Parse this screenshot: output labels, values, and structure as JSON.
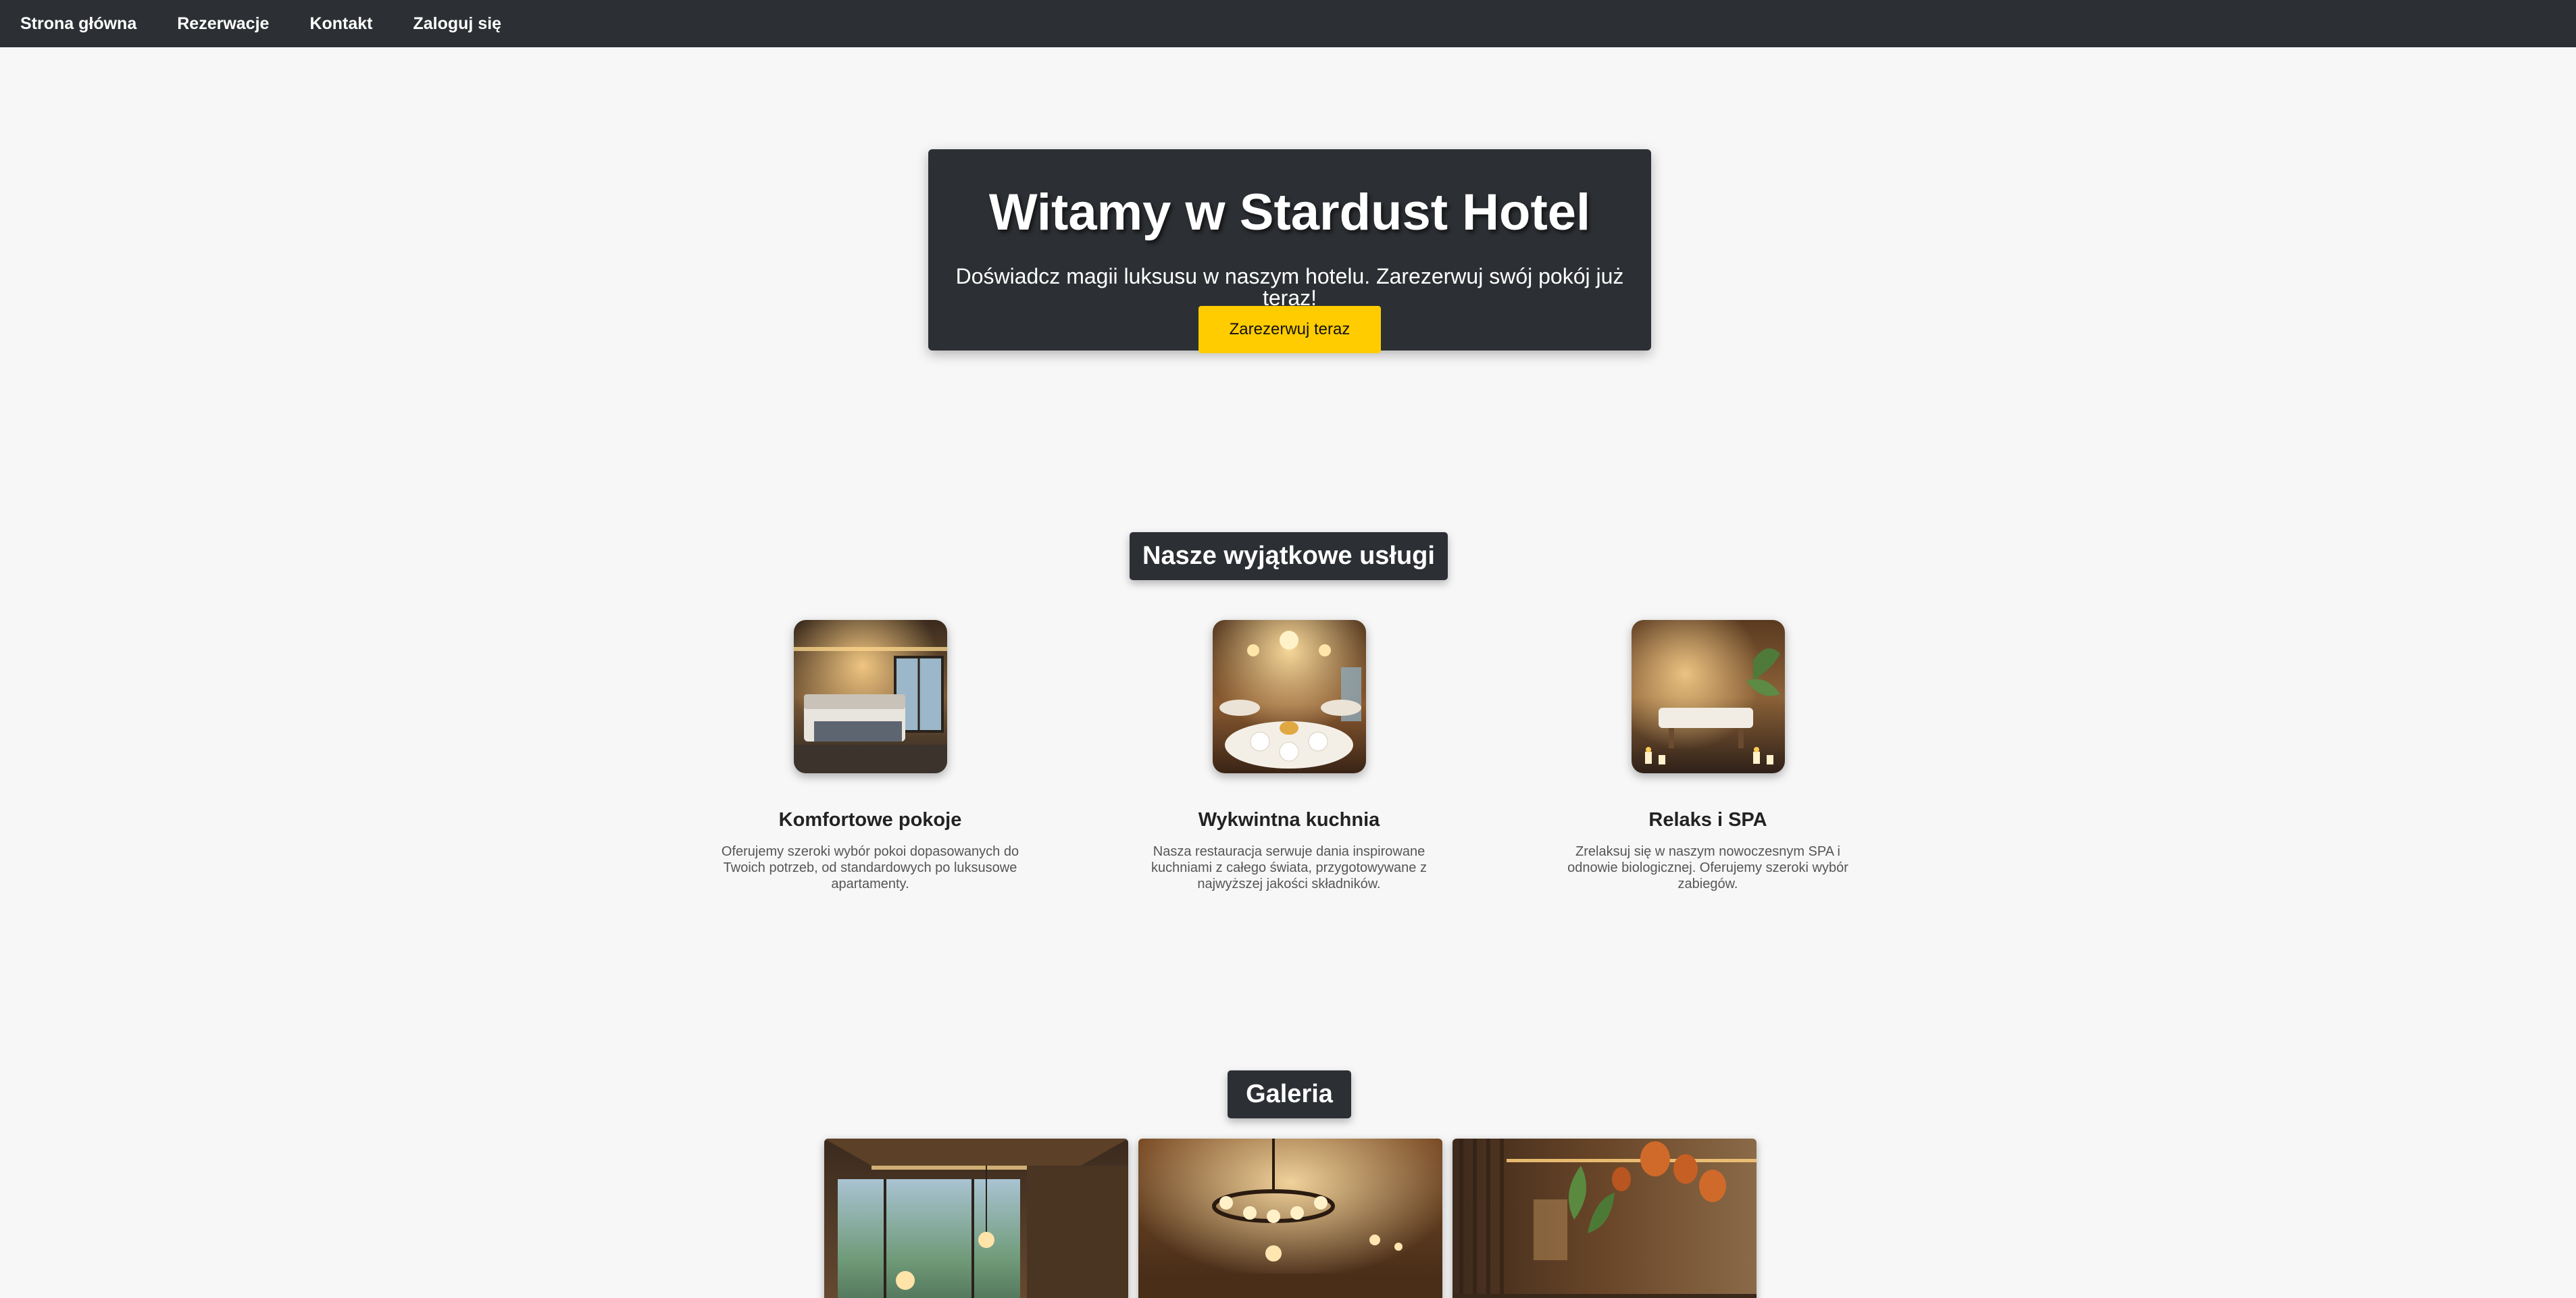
{
  "nav": {
    "items": [
      {
        "label": "Strona główna"
      },
      {
        "label": "Rezerwacje"
      },
      {
        "label": "Kontakt"
      },
      {
        "label": "Zaloguj się"
      }
    ]
  },
  "hero": {
    "title": "Witamy w Stardust Hotel",
    "subtitle": "Doświadcz magii luksusu w naszym hotelu. Zarezerwuj swój pokój już teraz!",
    "cta_label": "Zarezerwuj teraz"
  },
  "services": {
    "title": "Nasze wyjątkowe usługi",
    "items": [
      {
        "name": "Komfortowe pokoje",
        "description": "Oferujemy szeroki wybór pokoi dopasowanych do Twoich potrzeb, od standardowych po luksusowe apartamenty.",
        "image": "hotel-room-photo"
      },
      {
        "name": "Wykwintna kuchnia",
        "description": "Nasza restauracja serwuje dania inspirowane kuchniami z całego świata, przygotowywane z najwyższej jakości składników.",
        "image": "restaurant-photo"
      },
      {
        "name": "Relaks i SPA",
        "description": "Zrelaksuj się w naszym nowoczesnym SPA i odnowie biologicznej. Oferujemy szeroki wybór zabiegów.",
        "image": "spa-photo"
      }
    ]
  },
  "gallery": {
    "title": "Galeria",
    "images": [
      "lobby-photo",
      "dining-hall-photo",
      "lounge-photo"
    ]
  },
  "colors": {
    "nav_bg": "#2c2f33",
    "page_bg": "#f7f7f7",
    "accent": "#ffcc00"
  }
}
